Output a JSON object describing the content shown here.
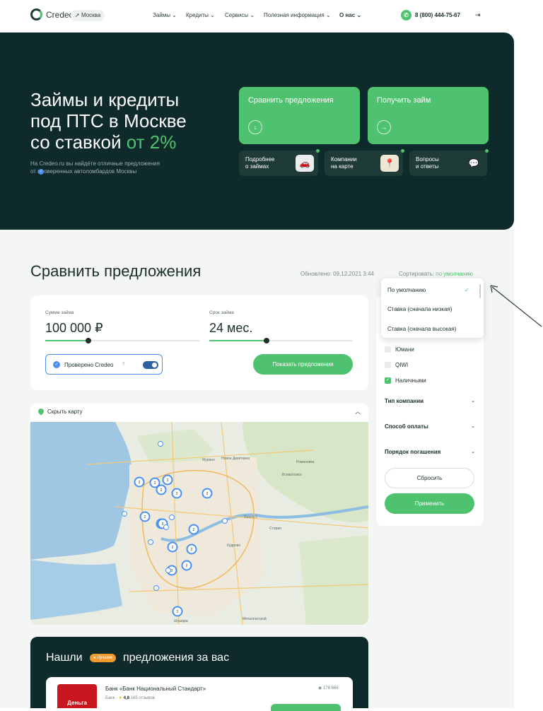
{
  "header": {
    "logo": "Credeo",
    "city": "Москва",
    "nav": [
      {
        "label": "Займы"
      },
      {
        "label": "Кредиты"
      },
      {
        "label": "Сервисы"
      },
      {
        "label": "Полезная информация"
      },
      {
        "label": "О нас"
      }
    ],
    "phone": "8 (800) 444-75-67"
  },
  "hero": {
    "title_line1": "Займы и кредиты",
    "title_line2": "под ПТС в Москве",
    "title_line3_prefix": "со ставкой ",
    "title_line3_accent": "от 2%",
    "subtitle_line1": "На Credeo.ru вы найдёте отличные предложения",
    "subtitle_line2": "от  проверенных автоломбардов Москвы",
    "cards": [
      {
        "label": "Сравнить предложения",
        "icon": "arrow-down-icon"
      },
      {
        "label": "Получить займ",
        "icon": "arrow-right-icon"
      }
    ],
    "small_cards": [
      {
        "line1": "Подробнее",
        "line2": "о займах"
      },
      {
        "line1": "Компании",
        "line2": "на карте"
      },
      {
        "line1": "Вопросы",
        "line2": "и ответы"
      }
    ]
  },
  "compare": {
    "title": "Сравнить предложения",
    "updated": "Обновлено: 09.12.2021 3:44",
    "sort_label": "Сортировать: ",
    "sort_value": "по умолчанию",
    "amount_caption": "Сумма займа",
    "amount_value": "100 000 ₽",
    "amount_fill": 0.28,
    "term_caption": "Срок займа",
    "term_value": "24 мес.",
    "term_fill": 0.4,
    "verified_label": "Проверено Credeo",
    "verified_hint": "?",
    "show_button": "Показать предложения"
  },
  "map": {
    "toggle_label": "Скрыть карту",
    "labels": [
      {
        "text": "Мурино"
      },
      {
        "text": "Новое Девяткино"
      },
      {
        "text": "Всеволожск"
      },
      {
        "text": "Кудрово"
      },
      {
        "text": "Янино-1"
      },
      {
        "text": "Шушары"
      },
      {
        "text": "Старая"
      },
      {
        "text": "Металлострой"
      },
      {
        "text": "Романовка"
      }
    ],
    "clusters": [
      "2",
      "2",
      "2",
      "2",
      "2",
      "2",
      "2",
      "2",
      "2",
      "2",
      "2",
      "2",
      "2",
      "3",
      "2"
    ]
  },
  "sort_dropdown": {
    "options": [
      {
        "label": "По умолчанию",
        "selected": true
      },
      {
        "label": "Ставка (сначала низкая)"
      },
      {
        "label": "Ставка (сначала высокая)"
      }
    ]
  },
  "filters": {
    "payment_methods": [
      {
        "label": "Юмани",
        "checked": false
      },
      {
        "label": "QIWI",
        "checked": false
      },
      {
        "label": "Наличными",
        "checked": true
      }
    ],
    "sections": [
      {
        "label": "Тип компании"
      },
      {
        "label": "Способ оплаты"
      },
      {
        "label": "Порядок погашения"
      }
    ],
    "reset_button": "Сбросить",
    "apply_button": "Применить"
  },
  "offers": {
    "title_prefix": "Нашли",
    "badge": "Лучшие",
    "title_suffix": "предложения за вас",
    "card": {
      "logo_text": "Деньга",
      "name": "Банк «Банк Национальный Стандарт»",
      "type": "Банк",
      "rating": "4,8",
      "reviews": "165 отзывов",
      "views": "178 666"
    }
  },
  "colors": {
    "accent": "#4fc26f",
    "dark": "#0f2a2b",
    "verified_blue": "#4b8ff0"
  }
}
